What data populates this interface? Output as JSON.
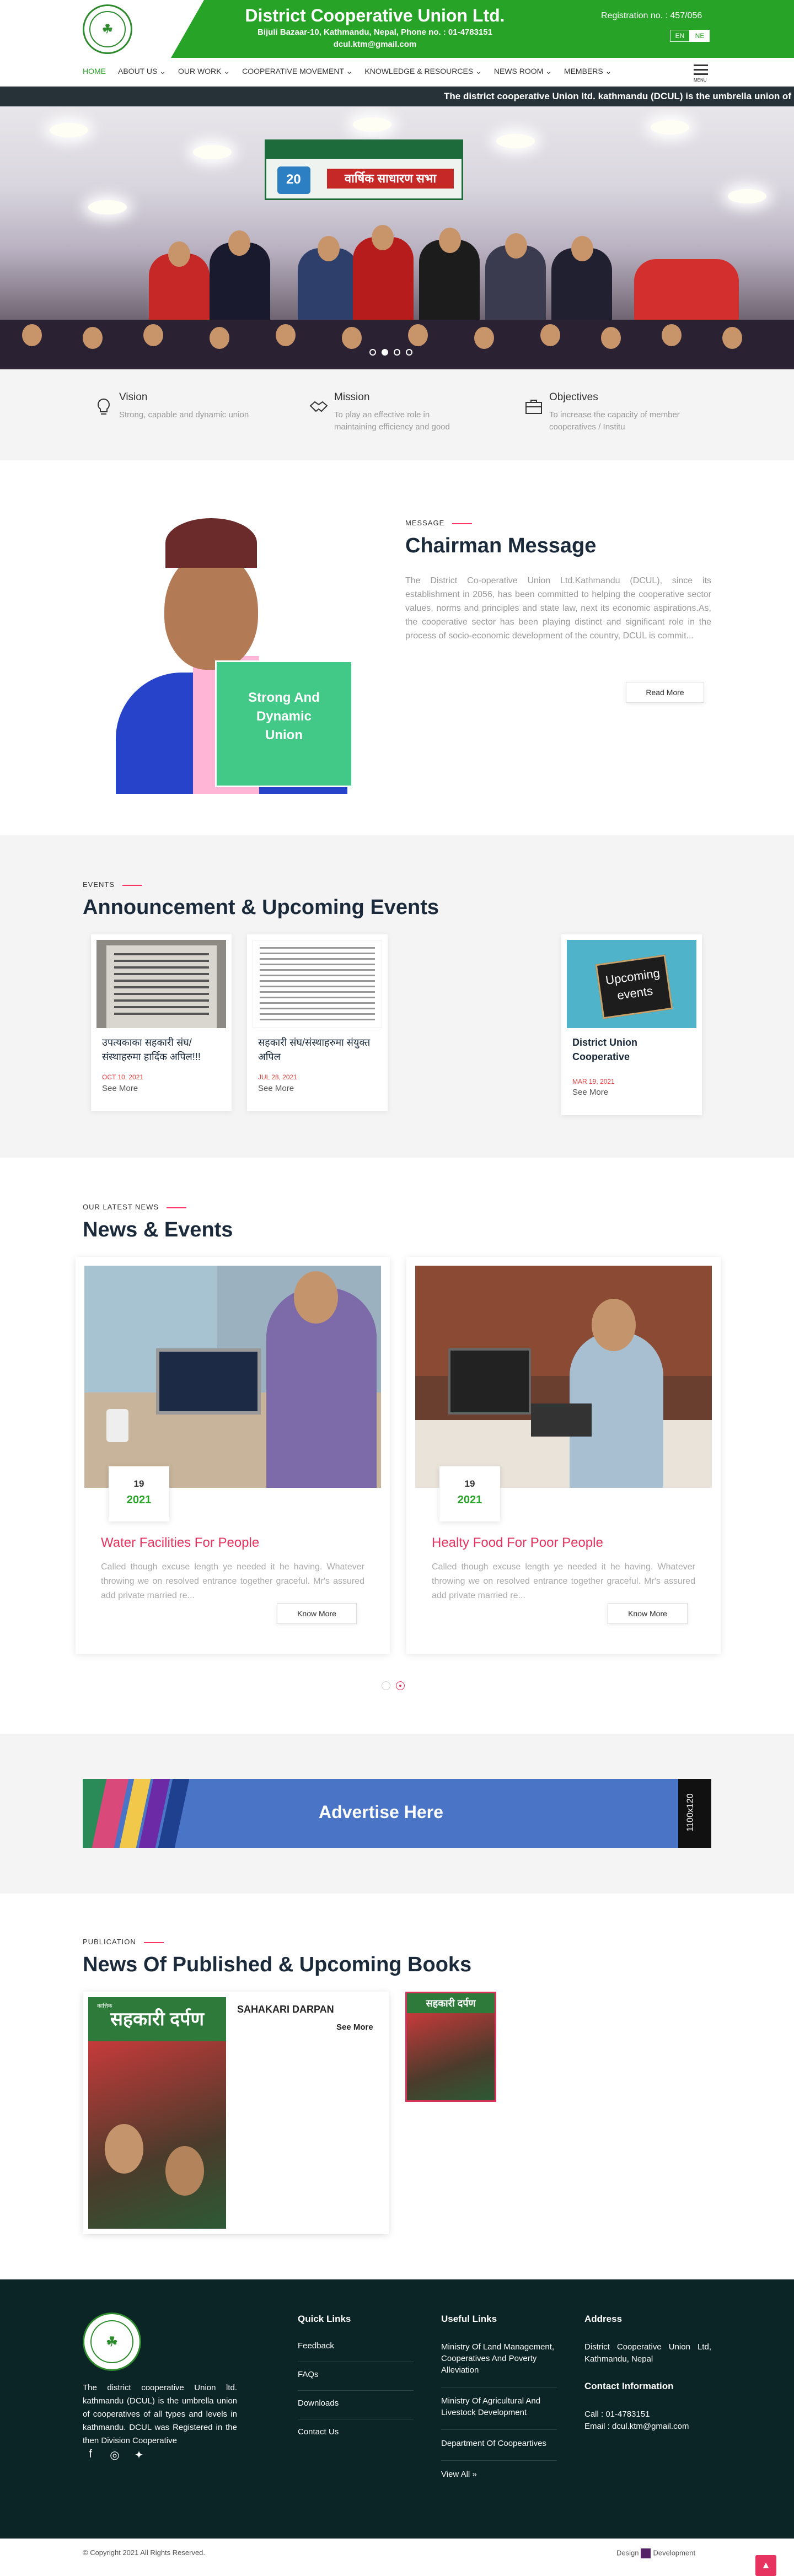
{
  "header": {
    "title": "District Cooperative Union Ltd.",
    "address": "Bijuli Bazaar-10, Kathmandu, Nepal, Phone no. : 01-4783151",
    "email": "dcul.ktm@gmail.com",
    "registration": "Registration no. : 457/056",
    "lang_en": "EN",
    "lang_ne": "NE",
    "logo_text": "DCU"
  },
  "nav": {
    "items": [
      "HOME",
      "ABOUT US",
      "OUR WORK",
      "COOPERATIVE MOVEMENT",
      "KNOWLEDGE & RESOURCES",
      "NEWS ROOM",
      "MEMBERS"
    ],
    "menu_label": "MENU"
  },
  "ticker": "The district cooperative Union ltd. kathmandu (DCUL) is the umbrella union of cooperatives",
  "hero": {
    "banner_text": "वार्षिक साधारण सभा",
    "badge": "20"
  },
  "vmo": [
    {
      "title": "Vision",
      "text": "Strong, capable and dynamic union"
    },
    {
      "title": "Mission",
      "text": "To play an effective role in maintaining efficiency and good"
    },
    {
      "title": "Objectives",
      "text": "To increase the capacity of member cooperatives / Institu"
    }
  ],
  "chairman": {
    "tag": "MESSAGE",
    "title": "Chairman Message",
    "text": "The District Co-operative Union Ltd.Kathmandu (DCUL), since its establishment in 2056, has been committed to helping the cooperative sector values, norms and principles and state law,  next its economic aspirations.As, the cooperative sector has been playing distinct and significant role in the process of socio-economic development of the country, DCUL is commit...",
    "button": "Read More",
    "badge_lines": [
      "Strong And",
      "Dynamic",
      "Union"
    ]
  },
  "events": {
    "tag": "EVENTS",
    "title": "Announcement & Upcoming Events",
    "items": [
      {
        "title": "उपत्यकाका सहकारी संघ/संस्थाहरुमा हार्दिक अपिल!!!",
        "date": "OCT 10, 2021",
        "more": "See More"
      },
      {
        "title": "सहकारी संघ/संस्थाहरुमा संयुक्त अपिल",
        "date": "JUL 28, 2021",
        "more": "See More"
      },
      {
        "title": "District Union Cooperative",
        "date": "MAR 19, 2021",
        "more": "See More",
        "sign_line1": "Upcoming",
        "sign_line2": "events"
      }
    ]
  },
  "news": {
    "tag": "OUR LATEST NEWS",
    "title": "News & Events",
    "items": [
      {
        "day": "19",
        "year": "2021",
        "title": "Water Facilities For People",
        "text": "Called though excuse length ye needed it he having. Whatever throwing we on resolved entrance together graceful. Mr's assured add private married re...",
        "button": "Know More"
      },
      {
        "day": "19",
        "year": "2021",
        "title": "Healty Food For Poor People",
        "text": "Called though excuse length ye needed it he having. Whatever throwing we on resolved entrance together graceful. Mr's assured add private married re...",
        "button": "Know More"
      }
    ]
  },
  "advert": {
    "text": "Advertise Here",
    "size": "1100x120"
  },
  "publication": {
    "tag": "PUBLICATION",
    "title": "News Of Published & Upcoming Books",
    "name": "SAHAKARI DARPAN",
    "more": "See More",
    "cover_title": "सहकारी दर्पण",
    "cover_small": "कात्तिक"
  },
  "footer": {
    "about": "The district cooperative Union ltd. kathmandu (DCUL) is the umbrella union of cooperatives of all types and levels in kathmandu. DCUL was Registered in the then Division Cooperative",
    "quick_title": "Quick Links",
    "quick": [
      "Feedback",
      "FAQs",
      "Downloads",
      "Contact Us"
    ],
    "useful_title": "Useful Links",
    "useful": [
      "Ministry Of Land Management, Cooperatives And Poverty Alleviation",
      "Ministry Of Agricultural And Livestock Development",
      "Department Of Coopeartives"
    ],
    "view_all": "View All »",
    "address_title": "Address",
    "address": "District Cooperative Union Ltd, Kathmandu, Nepal",
    "contact_title": "Contact Information",
    "call": "Call : 01-4783151",
    "email": "Email : dcul.ktm@gmail.com"
  },
  "copyright": {
    "left": "© Copyright 2021 All Rights Reserved.",
    "design": "Design",
    "development": "Development"
  },
  "colors": {
    "brand_green": "#27a327",
    "accent_pink": "#e6335f",
    "footer_bg": "#0b2426",
    "ticker_bg": "#263238"
  }
}
